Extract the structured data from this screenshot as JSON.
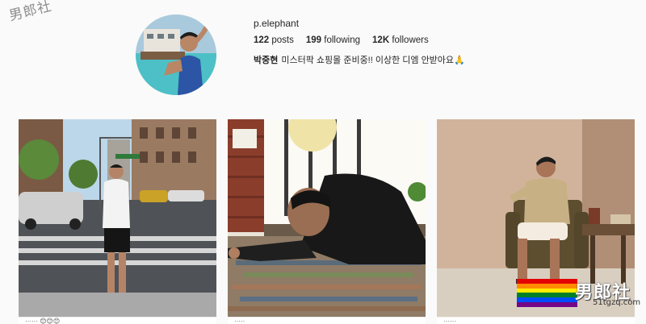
{
  "watermark_top": "男郎社",
  "profile": {
    "username": "p.elephant",
    "stats": {
      "posts_count": "122",
      "posts_label": "posts",
      "following_count": "199",
      "following_label": "following",
      "followers_count": "12K",
      "followers_label": "followers"
    },
    "bio_name": "박중현",
    "bio_text": "미스터팍 쇼핑몰 준비중!! 이상한 디엠 안받아요🙏"
  },
  "posts": [
    {
      "name": "post-street-photo",
      "caption": "······ 😊😊😊"
    },
    {
      "name": "post-cafe-photo",
      "caption": "·····"
    },
    {
      "name": "post-room-photo",
      "caption": "······"
    }
  ],
  "watermark_bottom": {
    "text": "男郎社",
    "url": "51tgzq.com",
    "rainbow_colors": [
      "#e40303",
      "#ff8c00",
      "#ffed00",
      "#008026",
      "#004dff",
      "#750787"
    ]
  },
  "colors": {
    "background": "#fafafa",
    "text": "#262626"
  }
}
